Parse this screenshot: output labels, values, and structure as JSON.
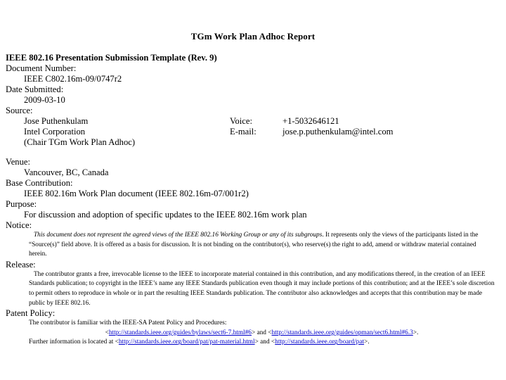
{
  "document": {
    "title": "TGm Work Plan Adhoc Report",
    "template_heading": "IEEE 802.16 Presentation Submission Template (Rev. 9)",
    "fields": {
      "document_number_label": "Document Number:",
      "document_number_value": "IEEE C802.16m-09/0747r2",
      "date_submitted_label": "Date Submitted:",
      "date_submitted_value": "2009-03-10",
      "source_label": "Source:",
      "venue_label": "Venue:",
      "venue_value": "Vancouver, BC, Canada",
      "base_contribution_label": "Base Contribution:",
      "base_contribution_value": "IEEE 802.16m Work Plan document (IEEE 802.16m-07/001r2)",
      "purpose_label": "Purpose:",
      "purpose_value": "For discussion and adoption of specific updates to the IEEE 802.16m work plan",
      "notice_label": "Notice:",
      "release_label": "Release:",
      "patent_policy_label": "Patent Policy:"
    },
    "source": {
      "rows": [
        {
          "name": "Jose Puthenkulam",
          "label": "Voice:",
          "value": "+1-5032646121"
        },
        {
          "name": "Intel Corporation",
          "label": "E-mail:",
          "value": "jose.p.puthenkulam@intel.com"
        },
        {
          "name": "(Chair TGm Work Plan Adhoc)",
          "label": "",
          "value": ""
        }
      ]
    },
    "notice": {
      "italic_part": "This document does not represent the agreed views of the IEEE 802.16 Working Group or any of its subgroups",
      "roman_part": ". It represents only the views of the participants listed in the “Source(s)” field above. It is offered as a basis for discussion. It is not binding on the contributor(s), who reserve(s) the right to add, amend or withdraw material contained herein."
    },
    "release": {
      "text": "The contributor grants a free, irrevocable license to the IEEE to incorporate material contained in this contribution, and any modifications thereof, in the creation of an IEEE Standards publication; to copyright in the IEEE’s name any IEEE Standards publication even though it may include portions of this contribution; and at the IEEE’s sole discretion to permit others to reproduce in whole or in part the resulting IEEE Standards publication. The contributor also acknowledges and accepts that this contribution may be made public by IEEE 802.16."
    },
    "patent_policy": {
      "intro": "The contributor is familiar with the IEEE-SA Patent Policy and Procedures:",
      "link_line": {
        "open_bracket": "<",
        "link1_text": "http://standards.ieee.org/guides/bylaws/sect6-7.html#6",
        "close_bracket_and": "> and <",
        "link2_text": "http://standards.ieee.org/guides/opman/sect6.html#6.3",
        "end": ">."
      },
      "further_line": {
        "prefix": "Further information is located at <",
        "link3_text": "http://standards.ieee.org/board/pat/pat-material.html",
        "mid": "> and <",
        "link4_text": "http://standards.ieee.org/board/pat",
        "end": ">."
      }
    }
  },
  "colors": {
    "text": "#000000",
    "link": "#0000cc",
    "background": "#ffffff"
  }
}
